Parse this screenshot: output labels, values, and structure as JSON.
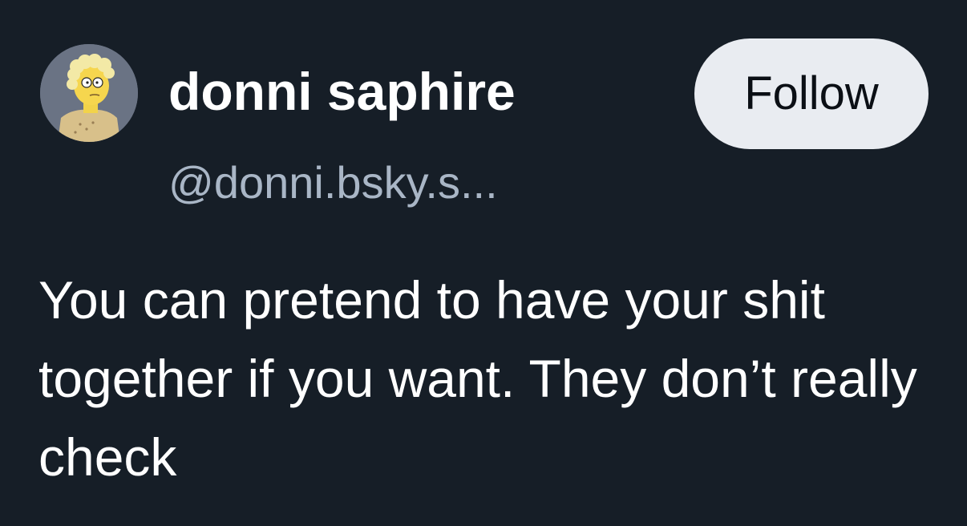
{
  "author": {
    "display_name": "donni saphire",
    "handle": "@donni.bsky.s..."
  },
  "follow_button": {
    "label": "Follow"
  },
  "post": {
    "text": "You can pretend to have your shit together if you want. They don’t really check"
  },
  "colors": {
    "background": "#161e27",
    "text_primary": "#ffffff",
    "text_secondary": "#a9b6c6",
    "button_background": "#e9ecf1",
    "button_text": "#0b0f15"
  }
}
